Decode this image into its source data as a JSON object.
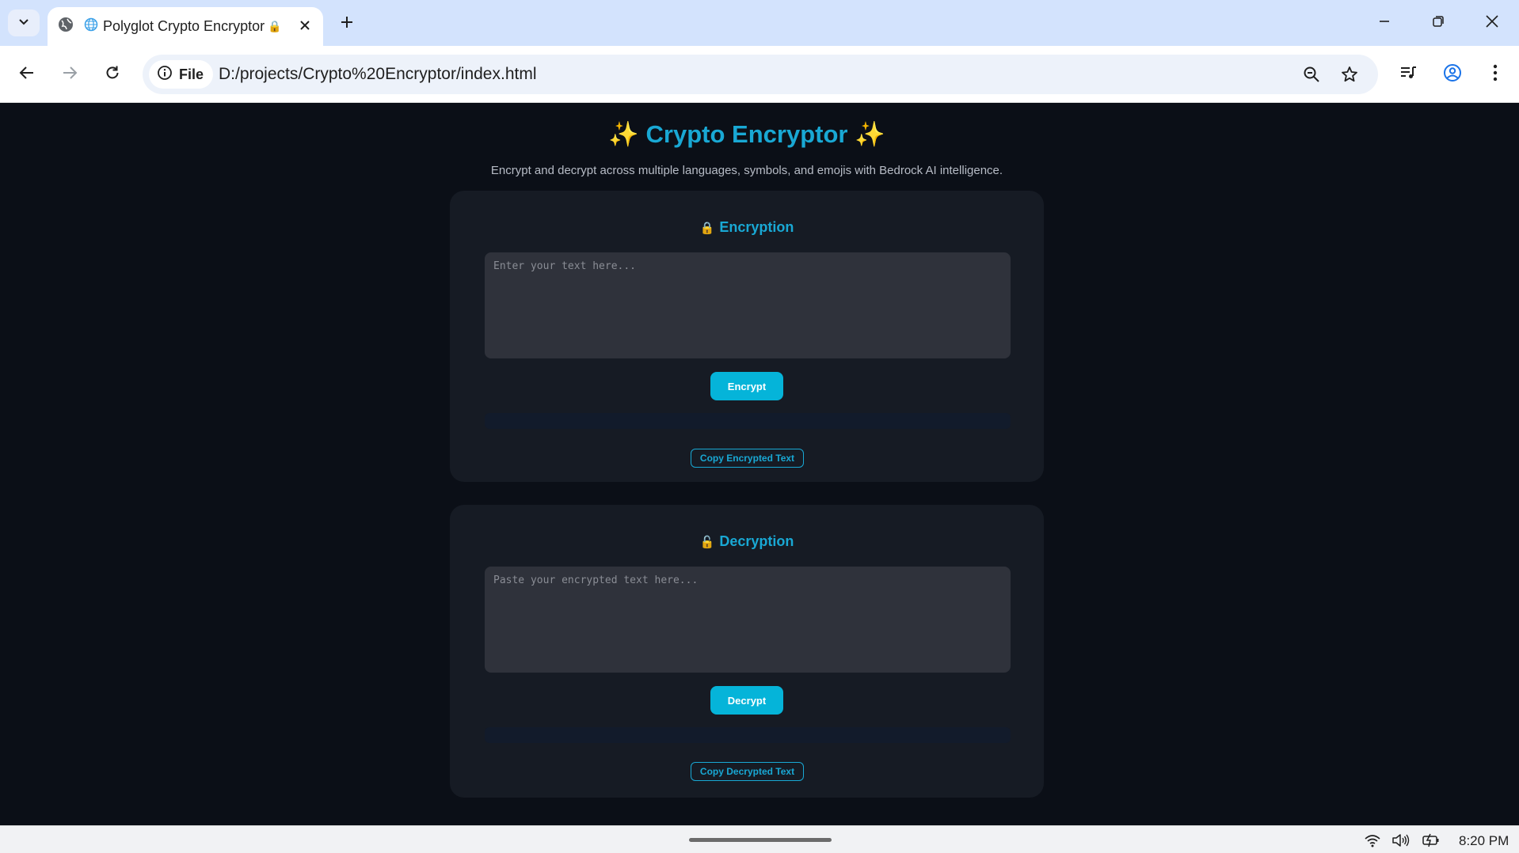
{
  "browser": {
    "tab": {
      "title": "Polyglot Crypto Encryptor",
      "favicon": "globe-icon",
      "title_emoji": "🔒"
    },
    "address": {
      "chip_label": "File",
      "url": "D:/projects/Crypto%20Encryptor/index.html"
    }
  },
  "page": {
    "title": "✨ Crypto Encryptor ✨",
    "subtitle": "Encrypt and decrypt across multiple languages, symbols, and emojis with Bedrock AI intelligence.",
    "encryption": {
      "heading_icon": "🔒",
      "heading": "Encryption",
      "input_placeholder": "Enter your text here...",
      "input_value": "",
      "action_label": "Encrypt",
      "output_value": "",
      "copy_label": "Copy Encrypted Text"
    },
    "decryption": {
      "heading_icon": "🔓",
      "heading": "Decryption",
      "input_placeholder": "Paste your encrypted text here...",
      "input_value": "",
      "action_label": "Decrypt",
      "output_value": "",
      "copy_label": "Copy Decrypted Text"
    }
  },
  "taskbar": {
    "clock": "8:20 PM"
  },
  "colors": {
    "accent": "#19a8d4",
    "button": "#05b4d9",
    "page_bg": "#0b0f17",
    "card_bg": "#161b24",
    "input_bg": "#2f323b",
    "tabstrip_bg": "#d3e3fd"
  }
}
